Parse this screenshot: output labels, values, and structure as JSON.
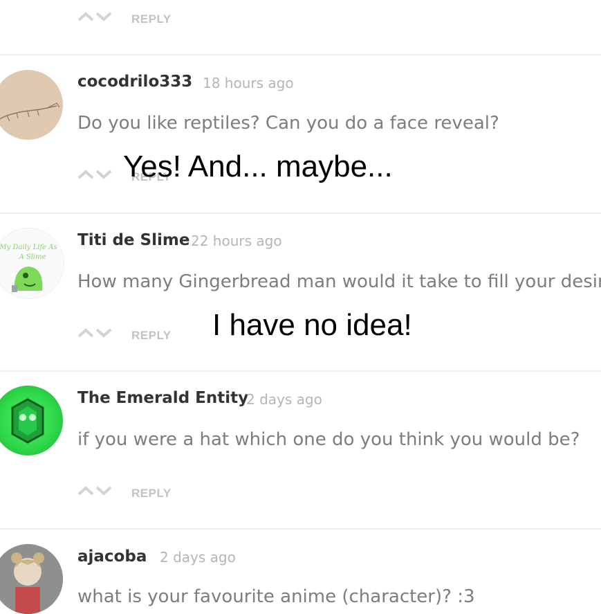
{
  "reply_label": "REPLY",
  "comments": [
    {
      "username": "cocodrilo333",
      "time": "18 hours ago",
      "text": "Do you like reptiles? Can you do a face reveal?"
    },
    {
      "username": "Titi de Slime",
      "time": "22 hours ago",
      "text": "How many Gingerbread man would it take to fill your desire"
    },
    {
      "username": "The Emerald Entity",
      "time": "2 days ago",
      "text": "if you were a hat which one do you think you would be?"
    },
    {
      "username": "ajacoba",
      "time": "2 days ago",
      "text": "what is your favourite anime (character)? :3"
    }
  ],
  "avatar_text": {
    "titi": "My Daily Life As A Slime"
  },
  "answers": [
    "Yes! And... maybe...",
    "I have no idea!"
  ],
  "colors": {
    "reply": "#c2c2c2",
    "username": "#333333",
    "text": "#7d7d7d",
    "time": "#b5b5b5",
    "emerald": "#2fd94a"
  }
}
